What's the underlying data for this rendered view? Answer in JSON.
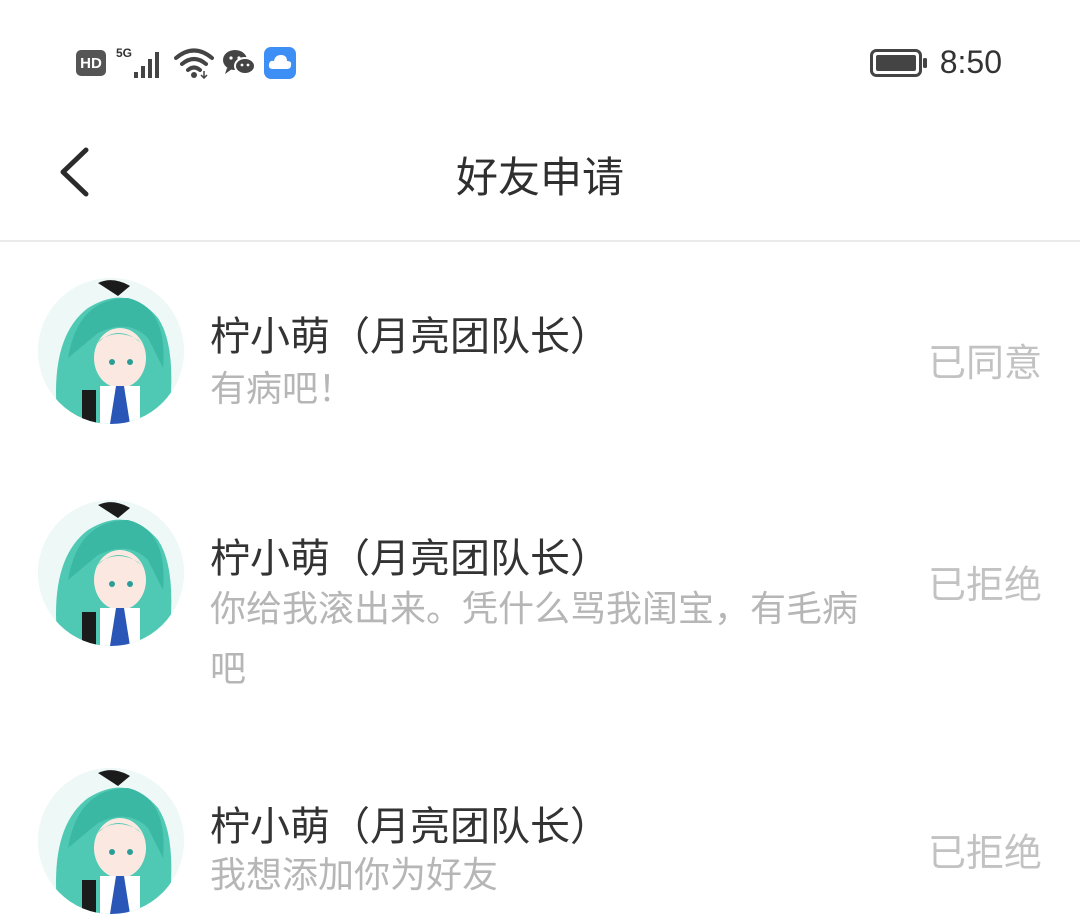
{
  "status_bar": {
    "hd_label": "HD",
    "network_label": "5G",
    "time": "8:50",
    "icons": [
      "hd-icon",
      "cellular-signal-icon",
      "wifi-icon",
      "wechat-icon",
      "cloud-app-icon",
      "battery-icon"
    ],
    "colors": {
      "cloud_app": "#3d8ef5",
      "icon_gray": "#444444"
    }
  },
  "header": {
    "title": "好友申请",
    "back_icon": "chevron-left-icon"
  },
  "requests": [
    {
      "name": "柠小萌（月亮团队长）",
      "message": "有病吧！",
      "status": "已同意"
    },
    {
      "name": "柠小萌（月亮团队长）",
      "message": "你给我滚出来。凭什么骂我闺宝，有毛病吧",
      "status": "已拒绝"
    },
    {
      "name": "柠小萌（月亮团队长）",
      "message": "我想添加你为好友",
      "status": "已拒绝"
    }
  ],
  "colors": {
    "name_text": "#333333",
    "message_text": "#b6b6b6",
    "status_text": "#c2c2c2",
    "divider": "#eaeaea"
  }
}
